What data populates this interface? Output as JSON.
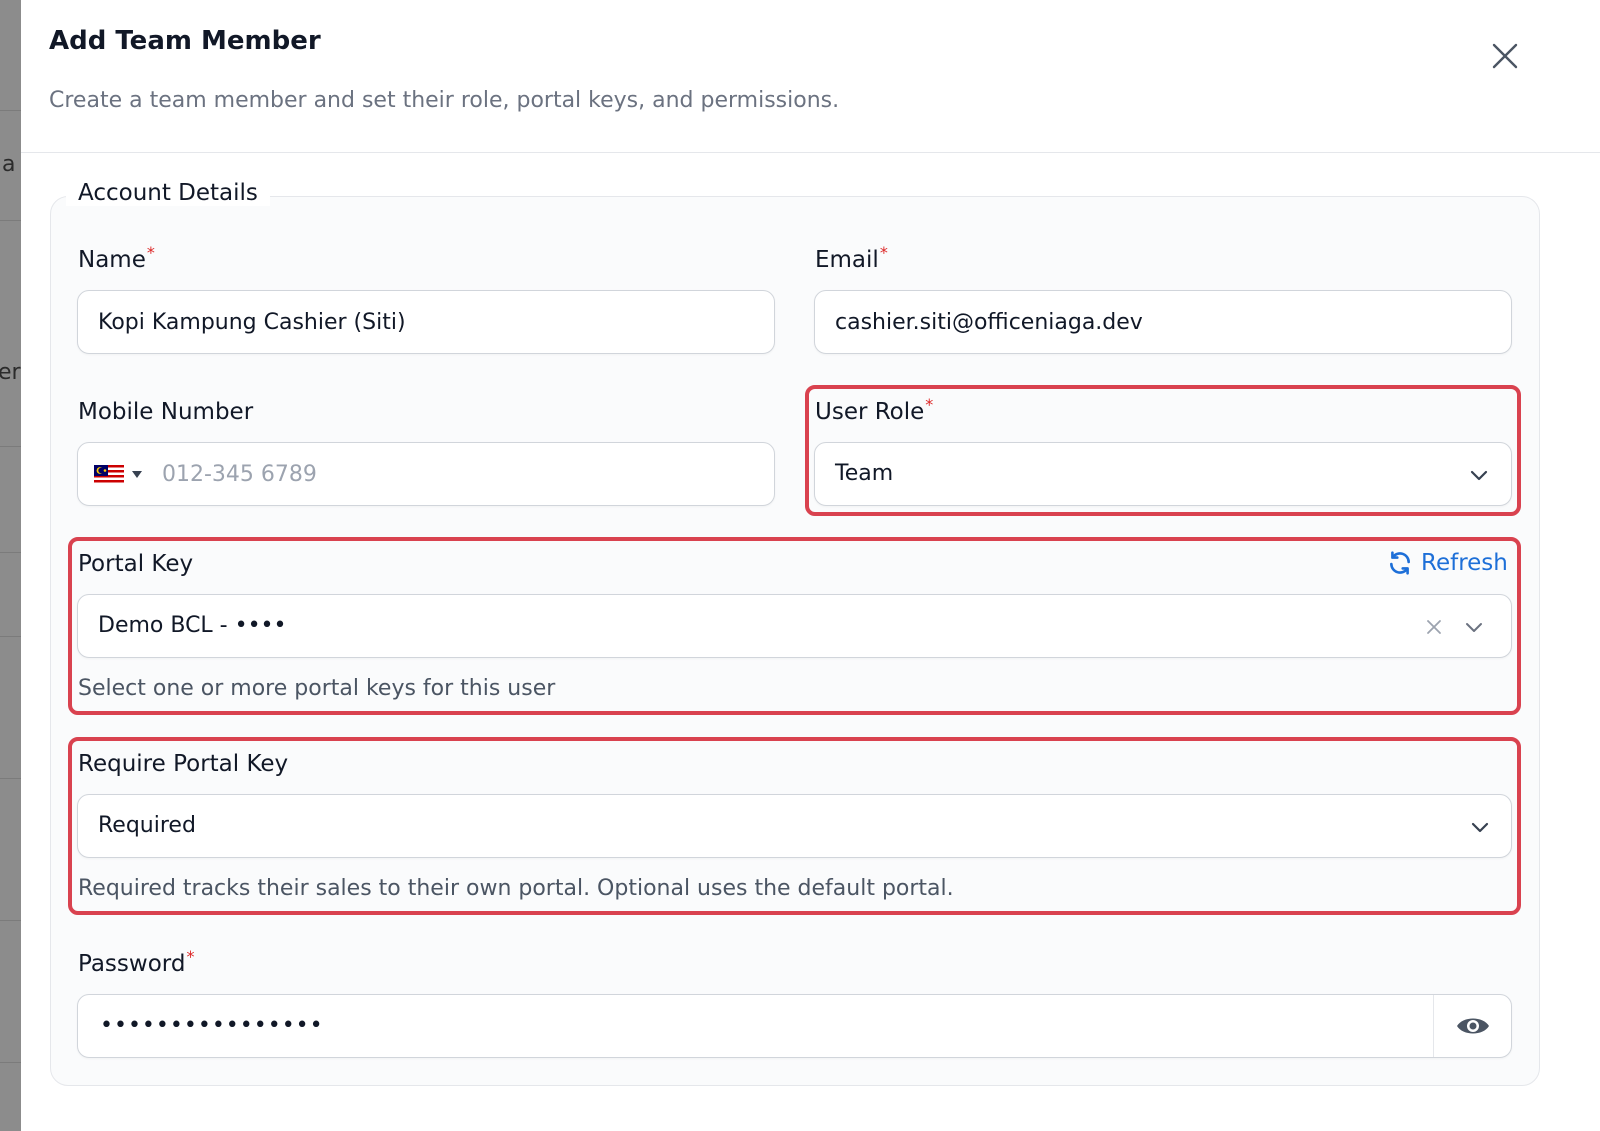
{
  "backdrop": {
    "text_a": "a",
    "text_er": "er"
  },
  "modal": {
    "title": "Add Team Member",
    "subtitle": "Create a team member and set their role, portal keys, and permissions."
  },
  "section": {
    "legend": "Account Details"
  },
  "fields": {
    "name": {
      "label": "Name",
      "value": "Kopi Kampung Cashier (Siti)"
    },
    "email": {
      "label": "Email",
      "value": "cashier.siti@officeniaga.dev"
    },
    "mobile": {
      "label": "Mobile Number",
      "placeholder": "012-345 6789"
    },
    "user_role": {
      "label": "User Role",
      "value": "Team"
    },
    "portal_key": {
      "label": "Portal Key",
      "refresh_label": "Refresh",
      "value": "Demo BCL - ••••",
      "help": "Select one or more portal keys for this user"
    },
    "require_portal_key": {
      "label": "Require Portal Key",
      "value": "Required",
      "help": "Required tracks their sales to their own portal. Optional uses the default portal."
    },
    "password": {
      "label": "Password",
      "value": "••••••••••••••••"
    },
    "required_marker": "*"
  },
  "colors": {
    "highlight": "#d9424f",
    "link": "#1d6fd8",
    "required": "#dc2626"
  },
  "icons": {
    "close": "close-icon",
    "flag": "malaysia-flag-icon",
    "chevron": "chevron-down-icon",
    "refresh": "refresh-icon",
    "clear": "clear-x-icon",
    "eye": "eye-icon"
  }
}
